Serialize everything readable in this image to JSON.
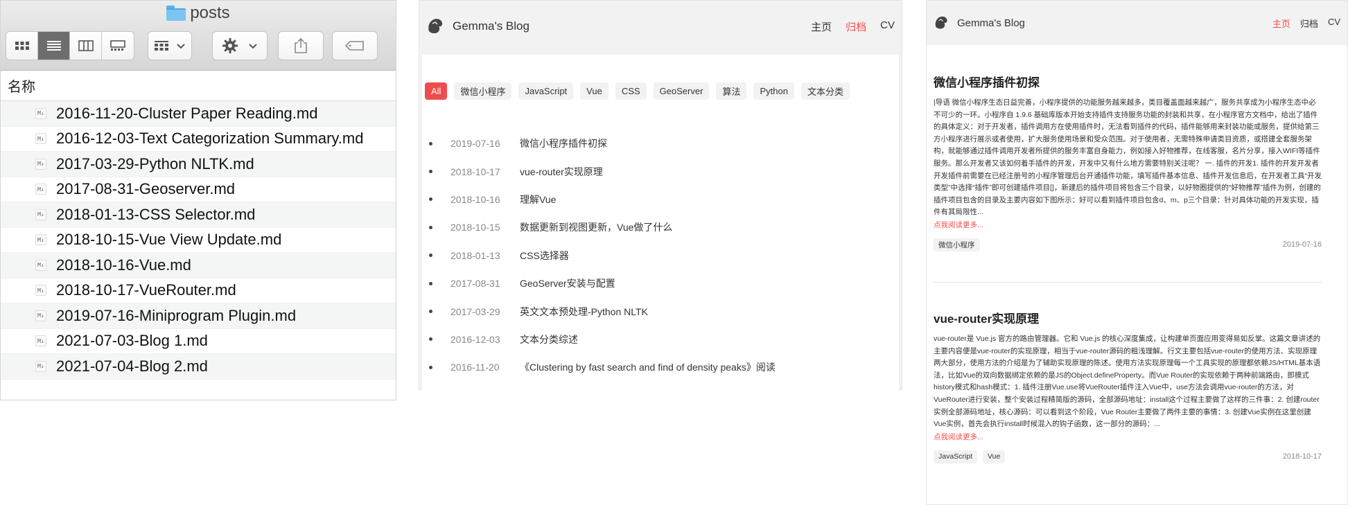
{
  "finder": {
    "title": "posts",
    "column_header": "名称",
    "files": [
      "2016-11-20-Cluster Paper Reading.md",
      "2016-12-03-Text Categorization Summary.md",
      "2017-03-29-Python NLTK.md",
      "2017-08-31-Geoserver.md",
      "2018-01-13-CSS Selector.md",
      "2018-10-15-Vue View Update.md",
      "2018-10-16-Vue.md",
      "2018-10-17-VueRouter.md",
      "2019-07-16-Miniprogram Plugin.md",
      "2021-07-03-Blog 1.md",
      "2021-07-04-Blog 2.md"
    ],
    "file_icon_label": "M↓"
  },
  "archive": {
    "blog_name": "Gemma's Blog",
    "nav": [
      "主页",
      "归档",
      "CV"
    ],
    "active_nav": "归档",
    "tags": [
      "All",
      "微信小程序",
      "JavaScript",
      "Vue",
      "CSS",
      "GeoServer",
      "算法",
      "Python",
      "文本分类"
    ],
    "active_tag": "All",
    "posts": [
      {
        "date": "2019-07-16",
        "title": "微信小程序插件初探"
      },
      {
        "date": "2018-10-17",
        "title": "vue-router实现原理"
      },
      {
        "date": "2018-10-16",
        "title": "理解Vue"
      },
      {
        "date": "2018-10-15",
        "title": "数据更新到视图更新，Vue做了什么"
      },
      {
        "date": "2018-01-13",
        "title": "CSS选择器"
      },
      {
        "date": "2017-08-31",
        "title": "GeoServer安装与配置"
      },
      {
        "date": "2017-03-29",
        "title": "英文文本预处理-Python NLTK"
      },
      {
        "date": "2016-12-03",
        "title": "文本分类综述"
      },
      {
        "date": "2016-11-20",
        "title": "《Clustering by fast search and find of density peaks》阅读"
      }
    ]
  },
  "home": {
    "blog_name": "Gemma's Blog",
    "nav": [
      "主页",
      "归档",
      "CV"
    ],
    "active_nav": "主页",
    "read_more": "点我阅读更多...",
    "articles": [
      {
        "title": "微信小程序插件初探",
        "excerpt": "|导语 微信小程序生态日益完善，小程序提供的功能服务越来越多，类目覆盖面越来越广，服务共享成为小程序生态中必不可少的一环。小程序自 1.9.6 基础库版本开始支持插件支持服务功能的封装和共享，在小程序官方文档中，给出了插件的具体定义：对于开发者，插件调用方在使用插件时，无法看到插件的代码，插件能够用来封装功能或服务，提供给第三方小程序进行展示或者使用，扩大服务使用场景和受众范围。对于使用者，无需特殊申请类目资质，或搭建全套服务架构，就能够通过插件调用开发者所提供的服务丰富自身能力，例如接入好物推荐，在线客服，名片分享，接入WIFI等插件服务。那么开发者又该如何着手插件的开发，开发中又有什么地方需要特别关注呢？ 一. 插件的开发1. 插件的开发开发者开发插件前需要在已经注册号的小程序管理后台开通插件功能，填写插件基本信息、插件开发信息后，在开发者工具“开发类型”中选择“插件”即可创建插件项目[]，新建后的插件项目将包含三个目录，以好物圈提供的“好物推荐”插件为例，创建的插件项目包含的目录及主要内容如下图所示：好可以看到插件项目包含d、m、p三个目录：针对具体功能的开发实现，插件有其局限性...",
        "tags": [
          "微信小程序"
        ],
        "date": "2019-07-16"
      },
      {
        "title": "vue-router实现原理",
        "excerpt": "vue-router是 Vue.js 官方的路由管理器。它和 Vue.js 的核心深度集成，让构建单页面应用变得易如反掌。这篇文章讲述的主要内容便是vue-router的实现原理，相当于vue-router源码的粗浅理解。行文主要包括vue-router的使用方法、实现原理两大部分，使用方法的介绍是为了辅助实现原理的陈述。使用方法实现原理每一个工具实现的原理都依赖JS/HTML基本语法，比如Vue的双向数据绑定依赖的是JS的Object.defineProperty。而Vue Router的实现依赖于两种前端路由，即模式history模式和hash模式：1. 插件注册Vue.use将VueRouter插件注入Vue中，use方法会调用vue-router的方法，对VueRouter进行安装，整个安装过程精简版的源码，全部源码地址：install这个过程主要做了这样的三件事：2. 创建router实例全部源码地址，核心源码：可以看到这个阶段，Vue Router主要做了两件主要的事情：3. 创建Vue实例在这里创建Vue实例，首先会执行install时候混入的钩子函数，这一部分的源码：...",
        "tags": [
          "JavaScript",
          "Vue"
        ],
        "date": "2018-10-17"
      }
    ]
  },
  "colors": {
    "accent": "#ef4d4d",
    "folder": "#7cc4f2",
    "muted_text": "#888888"
  }
}
